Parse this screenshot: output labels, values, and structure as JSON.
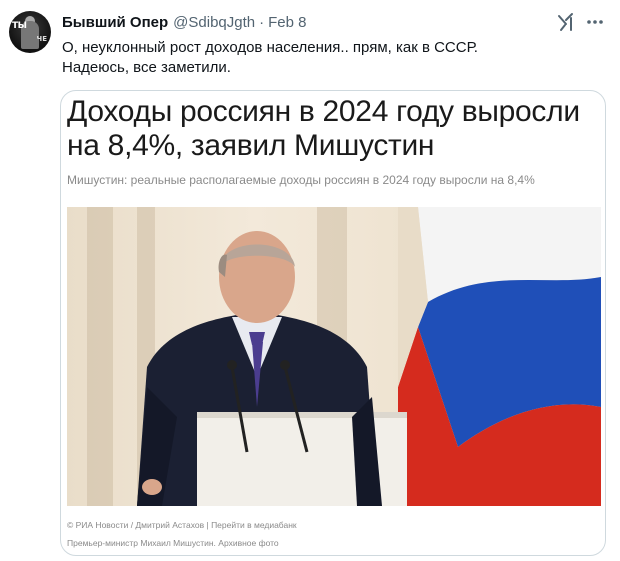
{
  "author": {
    "display_name": "Бывший Опер",
    "handle": "@SdibqJgth",
    "separator": "·",
    "date": "Feb 8",
    "avatar_text_left": "ТЫ",
    "avatar_text_right": "ЧЕ"
  },
  "tweet": {
    "line1": "О, неуклонный рост доходов населения.. прям, как в СССР.",
    "line2": "Надеюсь, все заметили."
  },
  "icons": {
    "grok": "grok-icon",
    "more": "more-icon"
  },
  "card": {
    "headline": "Доходы россиян в 2024 году выросли на 8,4%, заявил Мишустин",
    "subtitle": "Мишустин: реальные располагаемые доходы россиян в 2024 году выросли на 8,4%",
    "caption_source": "© РИА Новости / Дмитрий Астахов",
    "caption_divider": "|",
    "caption_link": "Перейти в медиабанк",
    "caption_description": "Премьер-министр Михаил Мишустин. Архивное фото"
  },
  "colors": {
    "flag_white": "#f4f4f4",
    "flag_blue": "#1f4fb8",
    "flag_red": "#d52b1e",
    "suit": "#1b2033",
    "tie": "#4b3d8f"
  }
}
